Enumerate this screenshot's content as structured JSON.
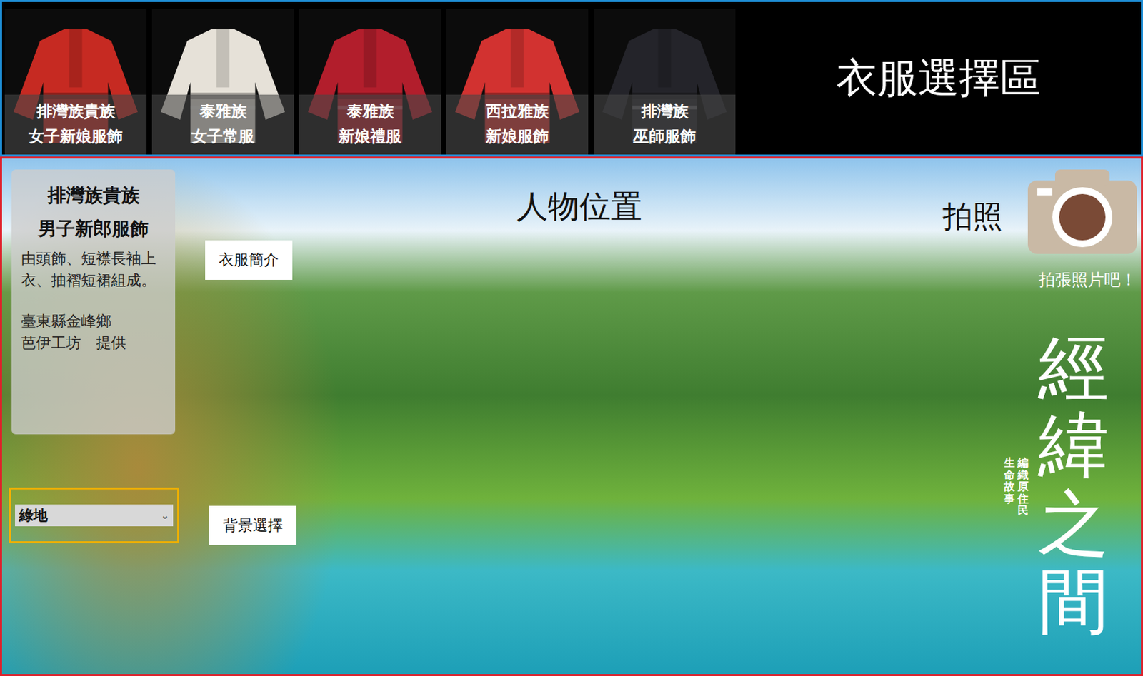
{
  "clothing_bar": {
    "annotation": "衣服選擇區",
    "items": [
      {
        "line1": "排灣族貴族",
        "line2": "女子新娘服飾",
        "color": "#c62a22",
        "selected": false
      },
      {
        "line1": "泰雅族",
        "line2": "女子常服",
        "color": "#e6e1d8",
        "selected": false
      },
      {
        "line1": "泰雅族",
        "line2": "新娘禮服",
        "color": "#b21e2c",
        "selected": false
      },
      {
        "line1": "西拉雅族",
        "line2": "新娘服飾",
        "color": "#d23230",
        "selected": false
      },
      {
        "line1": "排灣族",
        "line2": "巫師服飾",
        "color": "#24242a",
        "selected": false
      }
    ]
  },
  "stage": {
    "info_card": {
      "title_lines": [
        "排灣族貴族",
        "男子新郎服飾"
      ],
      "description": "由頭飾、短襟長袖上衣、抽褶短裙組成。",
      "credit_lines": [
        "臺東縣金峰鄉",
        "芭伊工坊　提供"
      ]
    },
    "info_label": "衣服簡介",
    "figure_label": "人物位置",
    "photo_label": "拍照",
    "photo_hint": "拍張照片吧！",
    "background_select": {
      "value": "綠地",
      "arrow": "⌄",
      "label": "背景選擇"
    },
    "logo": {
      "title": "經緯之間",
      "sub_right": "編織原住民",
      "sub_left": "生命故事"
    }
  }
}
